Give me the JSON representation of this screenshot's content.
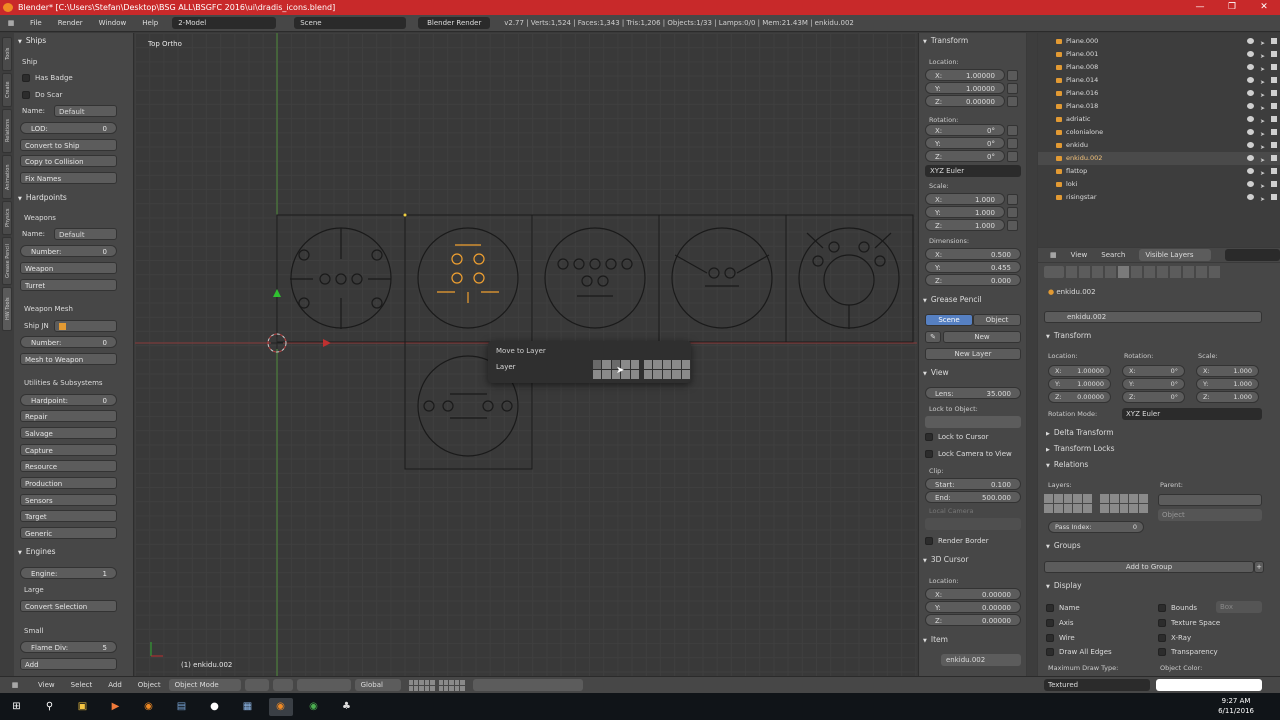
{
  "window": {
    "title": "Blender* [C:\\Users\\Stefan\\Desktop\\BSG ALL\\BSGFC 2016\\ui\\dradis_icons.blend]",
    "controls": [
      "—",
      "❐",
      "✕"
    ]
  },
  "topbar": {
    "menus": [
      "File",
      "Render",
      "Window",
      "Help"
    ],
    "layout": "2-Model",
    "scene": "Scene",
    "engine": "Blender Render",
    "stats": "v2.77 | Verts:1,524 | Faces:1,343 | Tris:1,206 | Objects:1/33 | Lamps:0/0 | Mem:21.43M | enkidu.002"
  },
  "toolshelf": {
    "tabs": [
      "Tools",
      "Create",
      "Relations",
      "Animation",
      "Physics",
      "Grease Pencil",
      "HW Tools"
    ],
    "ships_header": "Ships",
    "ship_label": "Ship",
    "has_badge": "Has Badge",
    "do_scar": "Do Scar",
    "name_label": "Name:",
    "name_value": "Default",
    "lod_label": "LOD:",
    "lod_value": "0",
    "btn_convert": "Convert to Ship",
    "btn_copy": "Copy to Collision",
    "btn_fix": "Fix Names",
    "hardpoints_header": "Hardpoints",
    "weapons_label": "Weapons",
    "hp_name_label": "Name:",
    "hp_name_value": "Default",
    "number_label": "Number:",
    "number_value": "0",
    "btn_weapon": "Weapon",
    "btn_turret": "Turret",
    "weapon_mesh_label": "Weapon Mesh",
    "ship_jn_label": "Ship JN",
    "number2_label": "Number:",
    "number2_value": "0",
    "btn_mesh_to_weapon": "Mesh to Weapon",
    "utilities_label": "Utilities & Subsystems",
    "hardpoint_label": "Hardpoint:",
    "hardpoint_value": "0",
    "btn_repair": "Repair",
    "btn_salvage": "Salvage",
    "btn_capture": "Capture",
    "btn_resource": "Resource",
    "btn_production": "Production",
    "btn_sensors": "Sensors",
    "btn_target": "Target",
    "btn_generic": "Generic",
    "engines_header": "Engines",
    "engine_label": "Engine:",
    "engine_value": "1",
    "large_label": "Large",
    "btn_convert_sel": "Convert Selection",
    "small_label": "Small",
    "flame_label": "Flame Div:",
    "flame_value": "5",
    "btn_add": "Add"
  },
  "viewport": {
    "view_label": "Top Ortho",
    "object_label": "(1) enkidu.002",
    "popup_title": "Move to Layer",
    "popup_layer_label": "Layer"
  },
  "npanel": {
    "transform_header": "Transform",
    "location_label": "Location:",
    "loc": [
      {
        "k": "X:",
        "v": "1.00000"
      },
      {
        "k": "Y:",
        "v": "1.00000"
      },
      {
        "k": "Z:",
        "v": "0.00000"
      }
    ],
    "rotation_label": "Rotation:",
    "rot": [
      {
        "k": "X:",
        "v": "0°"
      },
      {
        "k": "Y:",
        "v": "0°"
      },
      {
        "k": "Z:",
        "v": "0°"
      }
    ],
    "rot_mode": "XYZ Euler",
    "scale_label": "Scale:",
    "scale": [
      {
        "k": "X:",
        "v": "1.000"
      },
      {
        "k": "Y:",
        "v": "1.000"
      },
      {
        "k": "Z:",
        "v": "1.000"
      }
    ],
    "dimensions_label": "Dimensions:",
    "dims": [
      {
        "k": "X:",
        "v": "0.500"
      },
      {
        "k": "Y:",
        "v": "0.455"
      },
      {
        "k": "Z:",
        "v": "0.000"
      }
    ],
    "gp_header": "Grease Pencil",
    "gp_scene": "Scene",
    "gp_object": "Object",
    "gp_new": "New",
    "gp_new_layer": "New Layer",
    "view_header": "View",
    "lens_label": "Lens:",
    "lens_value": "35.000",
    "lock_label": "Lock to Object:",
    "lock_cursor": "Lock to Cursor",
    "lock_camera": "Lock Camera to View",
    "clip_label": "Clip:",
    "clip_start_label": "Start:",
    "clip_start": "0.100",
    "clip_end_label": "End:",
    "clip_end": "500.000",
    "local_camera": "Local Camera",
    "render_border": "Render Border",
    "cursor_header": "3D Cursor",
    "cursor_location": "Location:",
    "cursor": [
      {
        "k": "X:",
        "v": "0.00000"
      },
      {
        "k": "Y:",
        "v": "0.00000"
      },
      {
        "k": "Z:",
        "v": "0.00000"
      }
    ],
    "item_header": "Item",
    "item_name": "enkidu.002"
  },
  "outliner": {
    "items": [
      "Plane.000",
      "Plane.001",
      "Plane.008",
      "Plane.014",
      "Plane.016",
      "Plane.018",
      "adriatic",
      "colonialone",
      "enkidu",
      "enkidu.002",
      "flattop",
      "loki",
      "risingstar"
    ],
    "selected": "enkidu.002",
    "bar": [
      "View",
      "Search",
      "Visible Layers"
    ]
  },
  "properties": {
    "object_name": "enkidu.002",
    "name_field": "enkidu.002",
    "transform_header": "Transform",
    "location_label": "Location:",
    "rotation_label": "Rotation:",
    "scale_label": "Scale:",
    "loc": [
      {
        "k": "X:",
        "v": "1.00000"
      },
      {
        "k": "Y:",
        "v": "1.00000"
      },
      {
        "k": "Z:",
        "v": "0.00000"
      }
    ],
    "rot": [
      {
        "k": "X:",
        "v": "0°"
      },
      {
        "k": "Y:",
        "v": "0°"
      },
      {
        "k": "Z:",
        "v": "0°"
      }
    ],
    "scale": [
      {
        "k": "X:",
        "v": "1.000"
      },
      {
        "k": "Y:",
        "v": "1.000"
      },
      {
        "k": "Z:",
        "v": "1.000"
      }
    ],
    "rotation_mode_label": "Rotation Mode:",
    "rotation_mode": "XYZ Euler",
    "delta_transform": "Delta Transform",
    "transform_locks": "Transform Locks",
    "relations_header": "Relations",
    "layers_label": "Layers:",
    "parent_label": "Parent:",
    "parent_type": "Object",
    "pass_index_label": "Pass Index:",
    "pass_index": "0",
    "groups_header": "Groups",
    "add_to_group": "Add to Group",
    "display_header": "Display",
    "display_left": [
      "Name",
      "Axis",
      "Wire",
      "Draw All Edges"
    ],
    "display_right": [
      "Bounds",
      "Texture Space",
      "X-Ray",
      "Transparency"
    ],
    "bounds_type": "Box",
    "max_draw_label": "Maximum Draw Type:",
    "max_draw": "Textured",
    "object_color_label": "Object Color:"
  },
  "bottombar": {
    "menus": [
      "View",
      "Select",
      "Add",
      "Object"
    ],
    "mode": "Object Mode",
    "orientation": "Global"
  },
  "taskbar": {
    "time": "9:27 AM",
    "date": "6/11/2016"
  },
  "colors": {
    "titlebar": "#c8292a",
    "selected_orange": "#f0a030",
    "active_blue": "#5680c2"
  }
}
